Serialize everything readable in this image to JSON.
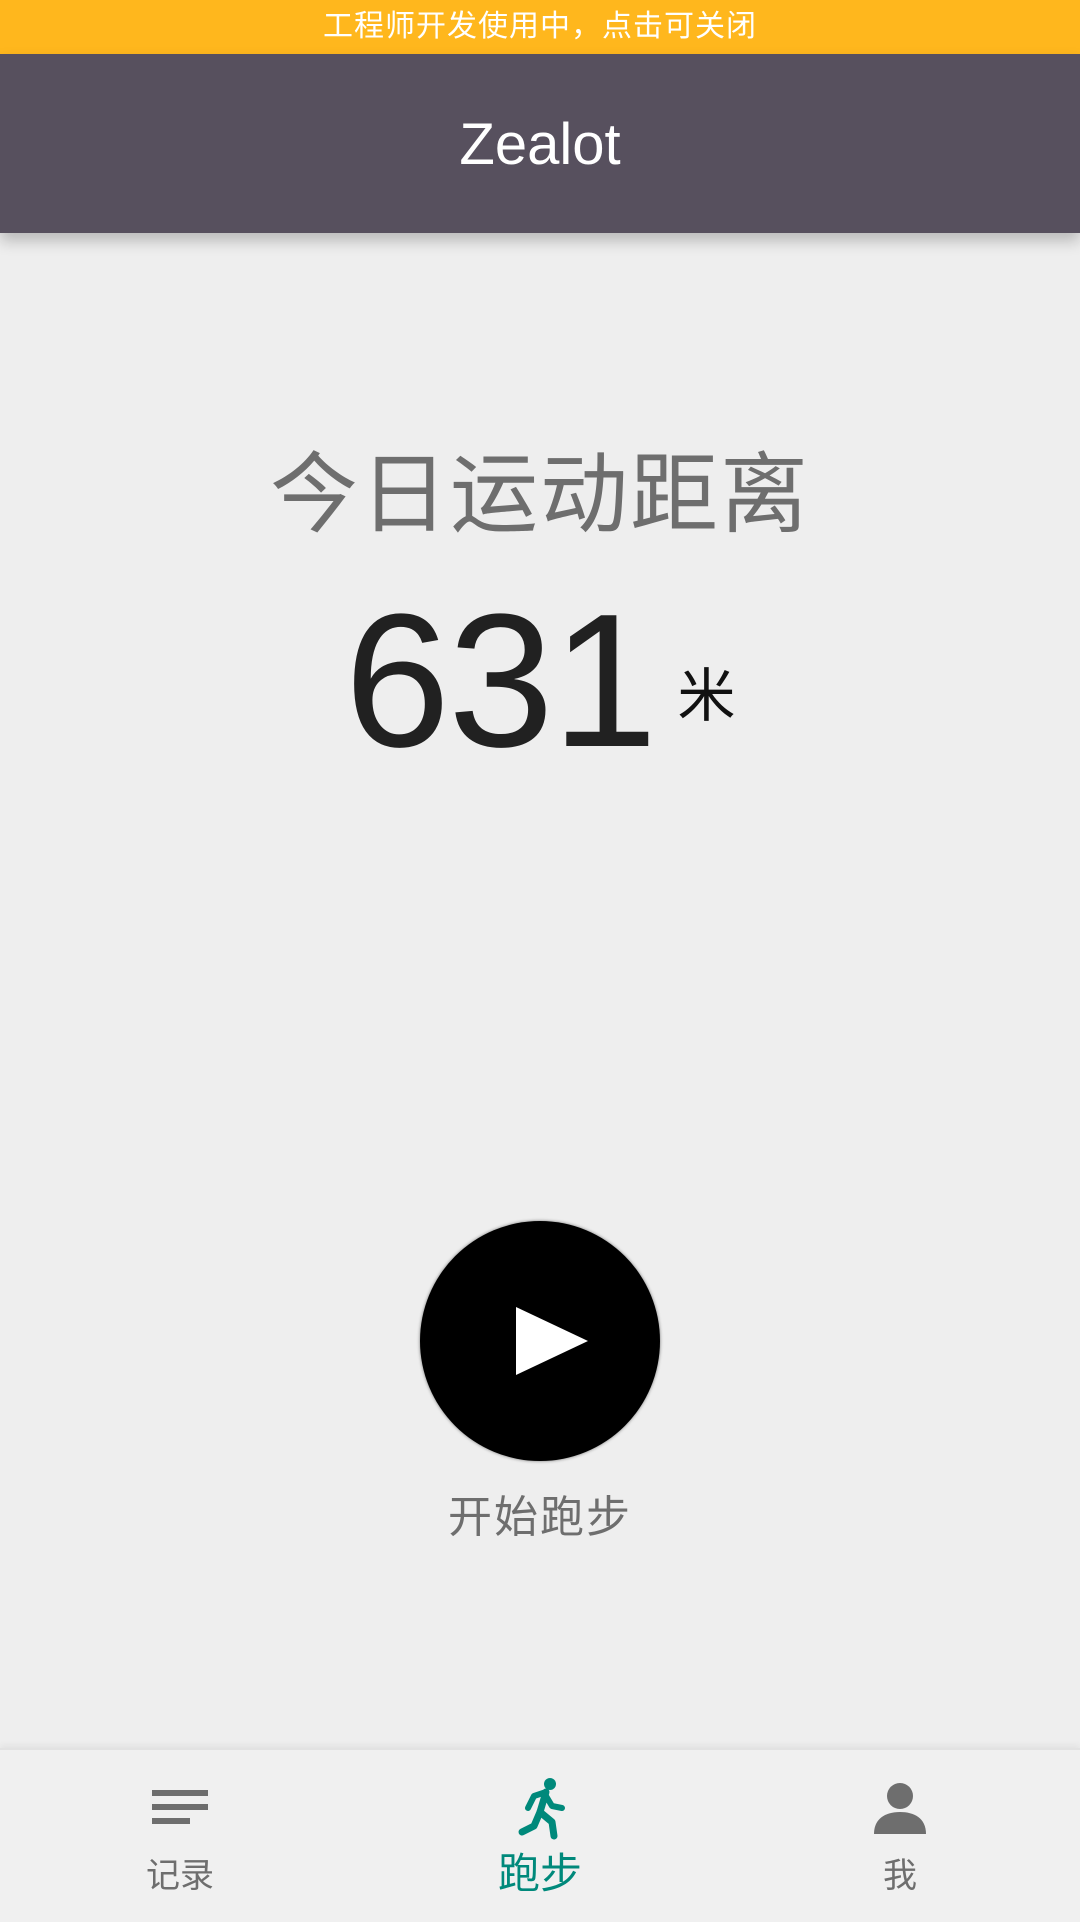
{
  "dev_banner": {
    "text": "工程师开发使用中，点击可关闭",
    "color": "#ffb71d"
  },
  "app_bar": {
    "title": "Zealot",
    "color": "#57505e"
  },
  "stats": {
    "label": "今日运动距离",
    "value": "631",
    "unit": "米"
  },
  "start_button": {
    "label": "开始跑步",
    "icon": "play-icon"
  },
  "bottom_nav": {
    "active_color": "#00897b",
    "items": [
      {
        "label": "记录",
        "icon": "list-icon",
        "active": false
      },
      {
        "label": "跑步",
        "icon": "running-icon",
        "active": true
      },
      {
        "label": "我",
        "icon": "person-icon",
        "active": false
      }
    ]
  }
}
